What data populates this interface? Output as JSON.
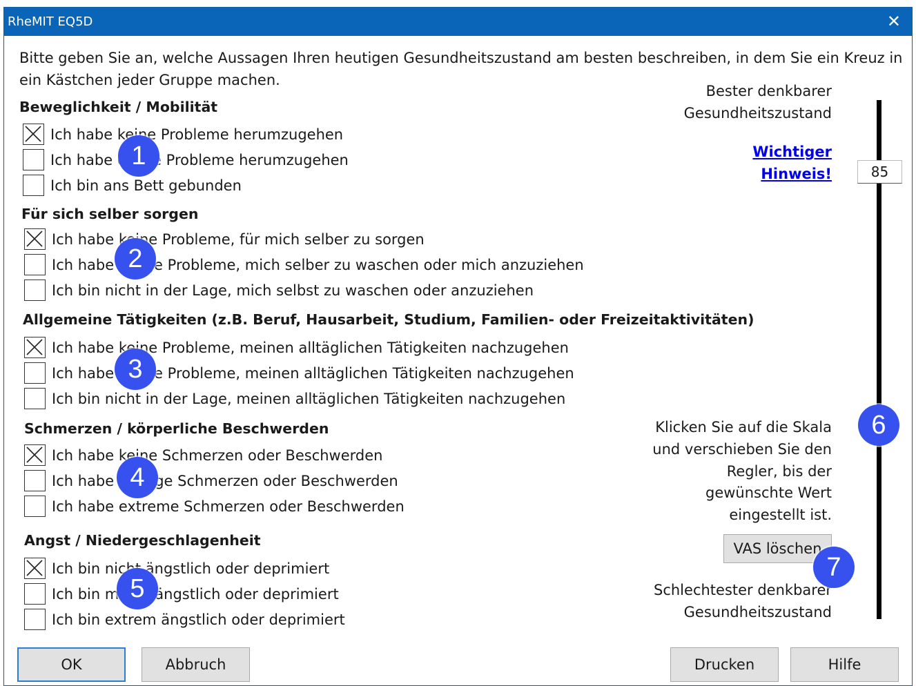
{
  "window": {
    "title": "RheMIT EQ5D",
    "close_glyph": "✕"
  },
  "intro": "Bitte geben Sie an, welche Aussagen Ihren heutigen Gesundheitszustand am besten beschreiben, in dem Sie ein Kreuz in ein Kästchen jeder Gruppe machen.",
  "groups": [
    {
      "heading": "Beweglichkeit / Mobilität",
      "badge": "1",
      "options": [
        {
          "label": "Ich habe keine Probleme herumzugehen",
          "checked": true
        },
        {
          "label": "Ich habe einige Probleme herumzugehen",
          "checked": false
        },
        {
          "label": "Ich bin ans Bett gebunden",
          "checked": false
        }
      ]
    },
    {
      "heading": "Für sich selber sorgen",
      "badge": "2",
      "options": [
        {
          "label": "Ich habe keine Probleme, für mich selber zu sorgen",
          "checked": true
        },
        {
          "label": "Ich habe einige Probleme, mich selber zu waschen oder mich anzuziehen",
          "checked": false
        },
        {
          "label": "Ich bin nicht in der Lage, mich selbst zu waschen oder anzuziehen",
          "checked": false
        }
      ]
    },
    {
      "heading": "Allgemeine Tätigkeiten (z.B. Beruf, Hausarbeit, Studium, Familien- oder Freizeitaktivitäten)",
      "badge": "3",
      "options": [
        {
          "label": "Ich habe keine Probleme, meinen alltäglichen Tätigkeiten nachzugehen",
          "checked": true
        },
        {
          "label": "Ich habe einige Probleme, meinen alltäglichen Tätigkeiten nachzugehen",
          "checked": false
        },
        {
          "label": "Ich bin nicht in der Lage, meinen alltäglichen Tätigkeiten nachzugehen",
          "checked": false
        }
      ]
    },
    {
      "heading": "Schmerzen / körperliche Beschwerden",
      "badge": "4",
      "options": [
        {
          "label": "Ich habe keine Schmerzen oder Beschwerden",
          "checked": true
        },
        {
          "label": "Ich habe mäßige Schmerzen oder Beschwerden",
          "checked": false
        },
        {
          "label": "Ich habe extreme Schmerzen oder Beschwerden",
          "checked": false
        }
      ]
    },
    {
      "heading": "Angst / Niedergeschlagenheit",
      "badge": "5",
      "options": [
        {
          "label": "Ich bin nicht ängstlich oder deprimiert",
          "checked": true
        },
        {
          "label": "Ich bin mäßig ängstlich oder deprimiert",
          "checked": false
        },
        {
          "label": "Ich bin extrem ängstlich oder deprimiert",
          "checked": false
        }
      ]
    }
  ],
  "vas": {
    "top_label_1": "Bester denkbarer",
    "top_label_2": "Gesundheitszustand",
    "link_1": "Wichtiger",
    "link_2": "Hinweis!",
    "value": "85",
    "hint_1": "Klicken Sie auf die Skala",
    "hint_2": "und verschieben Sie den",
    "hint_3": "Regler, bis der",
    "hint_4": "gewünschte Wert",
    "hint_5": "eingestellt ist.",
    "clear_button": "VAS löschen",
    "bottom_label_1": "Schlechtester denkbarer",
    "bottom_label_2": "Gesundheitszustand",
    "badge_scale": "6",
    "badge_clear": "7"
  },
  "buttons": {
    "ok": "OK",
    "cancel": "Abbruch",
    "print": "Drucken",
    "help": "Hilfe"
  },
  "colors": {
    "titlebar": "#0a64b8",
    "badge": "#3651ee",
    "link": "#0000ee"
  }
}
